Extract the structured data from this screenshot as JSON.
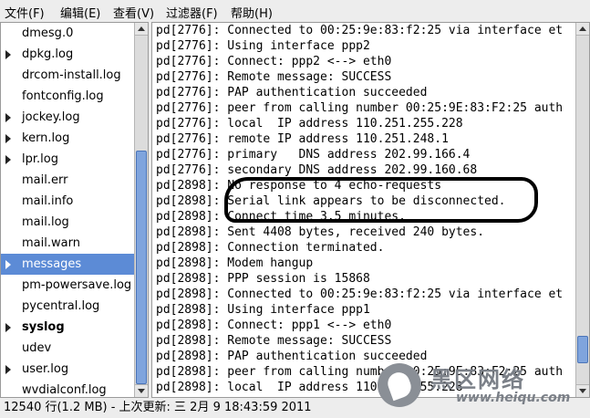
{
  "menubar": {
    "file": "文件(F)",
    "edit": "编辑(E)",
    "view": "查看(V)",
    "filters": "过滤器(F)",
    "help": "帮助(H)"
  },
  "files": [
    {
      "name": "dmesg.0",
      "arrow": false,
      "selected": false,
      "bold": false
    },
    {
      "name": "dpkg.log",
      "arrow": true,
      "selected": false,
      "bold": false
    },
    {
      "name": "drcom-install.log",
      "arrow": false,
      "selected": false,
      "bold": false
    },
    {
      "name": "fontconfig.log",
      "arrow": false,
      "selected": false,
      "bold": false
    },
    {
      "name": "jockey.log",
      "arrow": true,
      "selected": false,
      "bold": false
    },
    {
      "name": "kern.log",
      "arrow": true,
      "selected": false,
      "bold": false
    },
    {
      "name": "lpr.log",
      "arrow": true,
      "selected": false,
      "bold": false
    },
    {
      "name": "mail.err",
      "arrow": false,
      "selected": false,
      "bold": false
    },
    {
      "name": "mail.info",
      "arrow": false,
      "selected": false,
      "bold": false
    },
    {
      "name": "mail.log",
      "arrow": false,
      "selected": false,
      "bold": false
    },
    {
      "name": "mail.warn",
      "arrow": false,
      "selected": false,
      "bold": false
    },
    {
      "name": "messages",
      "arrow": true,
      "selected": true,
      "bold": false
    },
    {
      "name": "pm-powersave.log",
      "arrow": false,
      "selected": false,
      "bold": false
    },
    {
      "name": "pycentral.log",
      "arrow": false,
      "selected": false,
      "bold": false
    },
    {
      "name": "syslog",
      "arrow": true,
      "selected": false,
      "bold": true
    },
    {
      "name": "udev",
      "arrow": false,
      "selected": false,
      "bold": false
    },
    {
      "name": "user.log",
      "arrow": true,
      "selected": false,
      "bold": false
    },
    {
      "name": "wvdialconf.log",
      "arrow": false,
      "selected": false,
      "bold": false
    }
  ],
  "log_lines": [
    "pd[2776]: Connected to 00:25:9e:83:f2:25 via interface et",
    "pd[2776]: Using interface ppp2",
    "pd[2776]: Connect: ppp2 <--> eth0",
    "pd[2776]: Remote message: SUCCESS",
    "pd[2776]: PAP authentication succeeded",
    "pd[2776]: peer from calling number 00:25:9E:83:F2:25 auth",
    "pd[2776]: local  IP address 110.251.255.228",
    "pd[2776]: remote IP address 110.251.248.1",
    "pd[2776]: primary   DNS address 202.99.166.4",
    "pd[2776]: secondary DNS address 202.99.160.68",
    "pd[2898]: No response to 4 echo-requests",
    "pd[2898]: Serial link appears to be disconnected.",
    "pd[2898]: Connect time 3.5 minutes.",
    "pd[2898]: Sent 4408 bytes, received 240 bytes.",
    "pd[2898]: Connection terminated.",
    "pd[2898]: Modem hangup",
    "pd[2898]: PPP session is 15868",
    "pd[2898]: Connected to 00:25:9e:83:f2:25 via interface et",
    "pd[2898]: Using interface ppp1",
    "pd[2898]: Connect: ppp1 <--> eth0",
    "pd[2898]: Remote message: SUCCESS",
    "pd[2898]: PAP authentication succeeded",
    "pd[2898]: peer from calling number 00:25:9E:83:F2:25 auth",
    "pd[2898]: local  IP address 110.251.255.228"
  ],
  "statusbar": {
    "text": "12540 行(1.2 MB) - 上次更新: 三  2月  9 18:43:59 2011"
  },
  "watermark": {
    "title": "黑区网络",
    "url": "www.heiqu.com"
  },
  "colors": {
    "selection": "#5c8bd6",
    "scroll_thumb": "#7fa4dd"
  },
  "scroll": {
    "left_thumb_fraction_start": 0.33,
    "left_thumb_fraction_size": 0.67,
    "right_thumb_fraction_start": 0.86,
    "right_thumb_fraction_size": 0.08
  }
}
